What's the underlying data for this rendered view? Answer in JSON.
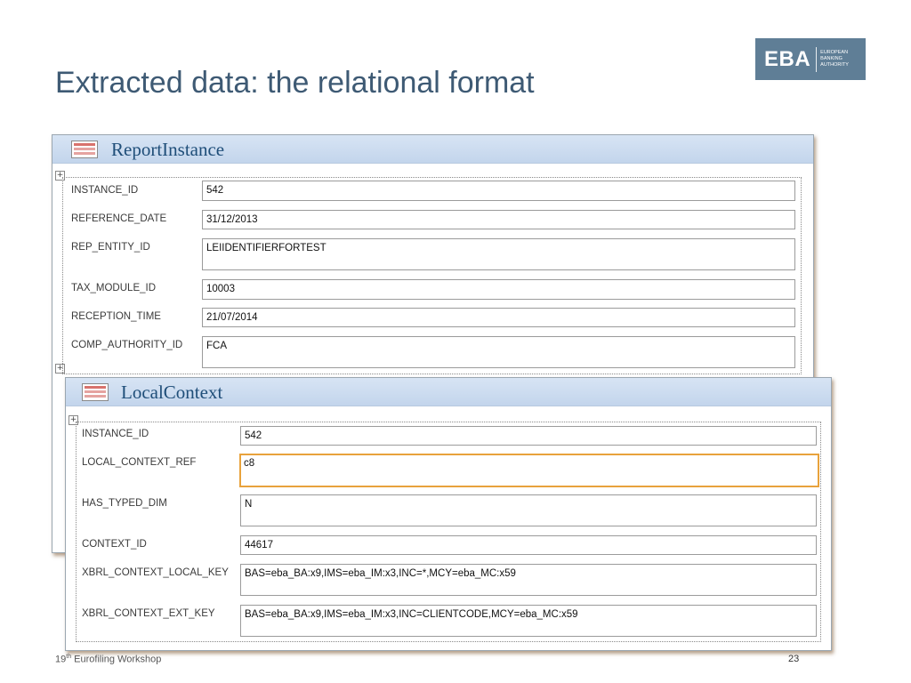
{
  "slide": {
    "title": "Extracted data: the relational format",
    "footer_num": "19",
    "footer_sup": "th",
    "footer_text": " Eurofiling Workshop",
    "page_number": "23"
  },
  "logo": {
    "mark": "EBA",
    "line1": "EUROPEAN",
    "line2": "BANKING",
    "line3": "AUTHORITY"
  },
  "report_instance": {
    "title": "ReportInstance",
    "fields": [
      {
        "label": "INSTANCE_ID",
        "value": "542"
      },
      {
        "label": "REFERENCE_DATE",
        "value": "31/12/2013"
      },
      {
        "label": "REP_ENTITY_ID",
        "value": "LEIIDENTIFIERFORTEST"
      },
      {
        "label": "TAX_MODULE_ID",
        "value": "10003"
      },
      {
        "label": "RECEPTION_TIME",
        "value": "21/07/2014"
      },
      {
        "label": "COMP_AUTHORITY_ID",
        "value": "FCA"
      }
    ]
  },
  "local_context": {
    "title": "LocalContext",
    "fields": [
      {
        "label": "INSTANCE_ID",
        "value": "542"
      },
      {
        "label": "LOCAL_CONTEXT_REF",
        "value": "c8"
      },
      {
        "label": "HAS_TYPED_DIM",
        "value": "N"
      },
      {
        "label": "CONTEXT_ID",
        "value": "44617"
      },
      {
        "label": "XBRL_CONTEXT_LOCAL_KEY",
        "value": "BAS=eba_BA:x9,IMS=eba_IM:x3,INC=*,MCY=eba_MC:x59"
      },
      {
        "label": "XBRL_CONTEXT_EXT_KEY",
        "value": "BAS=eba_BA:x9,IMS=eba_IM:x3,INC=CLIENTCODE,MCY=eba_MC:x59"
      }
    ]
  }
}
